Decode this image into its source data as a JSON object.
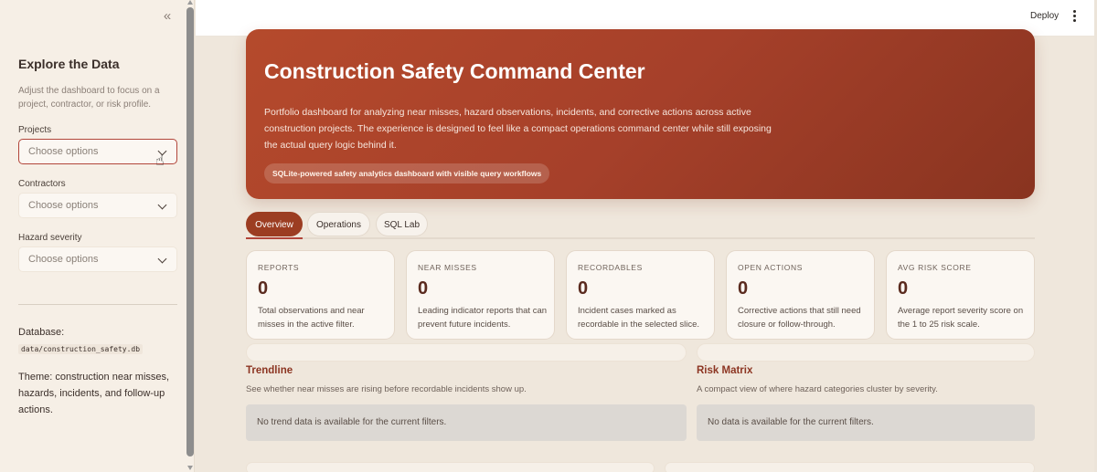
{
  "sidebar": {
    "title": "Explore the Data",
    "description": "Adjust the dashboard to focus on a project, contractor, or risk profile.",
    "filters": [
      {
        "label": "Projects",
        "placeholder": "Choose options"
      },
      {
        "label": "Contractors",
        "placeholder": "Choose options"
      },
      {
        "label": "Hazard severity",
        "placeholder": "Choose options"
      }
    ],
    "database_label": "Database:",
    "database_path": "data/construction_safety.db",
    "theme": "Theme: construction near misses, hazards, incidents, and follow-up actions.",
    "collapse_glyph": "«"
  },
  "topbar": {
    "deploy_label": "Deploy"
  },
  "hero": {
    "title": "Construction Safety Command Center",
    "description": "Portfolio dashboard for analyzing near misses, hazard observations, incidents, and corrective actions across active construction projects. The experience is designed to feel like a compact operations command center while still exposing the actual query logic behind it.",
    "pill": "SQLite-powered safety analytics dashboard with visible query workflows"
  },
  "tabs": [
    {
      "label": "Overview",
      "active": true
    },
    {
      "label": "Operations",
      "active": false
    },
    {
      "label": "SQL Lab",
      "active": false
    }
  ],
  "metrics": [
    {
      "label": "REPORTS",
      "value": "0",
      "desc": "Total observations and near misses in the active filter."
    },
    {
      "label": "NEAR MISSES",
      "value": "0",
      "desc": "Leading indicator reports that can prevent future incidents."
    },
    {
      "label": "RECORDABLES",
      "value": "0",
      "desc": "Incident cases marked as recordable in the selected slice."
    },
    {
      "label": "OPEN ACTIONS",
      "value": "0",
      "desc": "Corrective actions that still need closure or follow-through."
    },
    {
      "label": "AVG RISK SCORE",
      "value": "0",
      "desc": "Average report severity score on the 1 to 25 risk scale."
    }
  ],
  "sections": {
    "trendline": {
      "title": "Trendline",
      "subtitle": "See whether near misses are rising before recordable incidents show up.",
      "empty": "No trend data is available for the current filters."
    },
    "risk_matrix": {
      "title": "Risk Matrix",
      "subtitle": "A compact view of where hazard categories cluster by severity.",
      "empty": "No data is available for the current filters."
    }
  },
  "colors": {
    "accent": "#b2453a",
    "hero_start": "#b54a2c",
    "hero_end": "#893420",
    "tab_active": "#9c3d22"
  }
}
